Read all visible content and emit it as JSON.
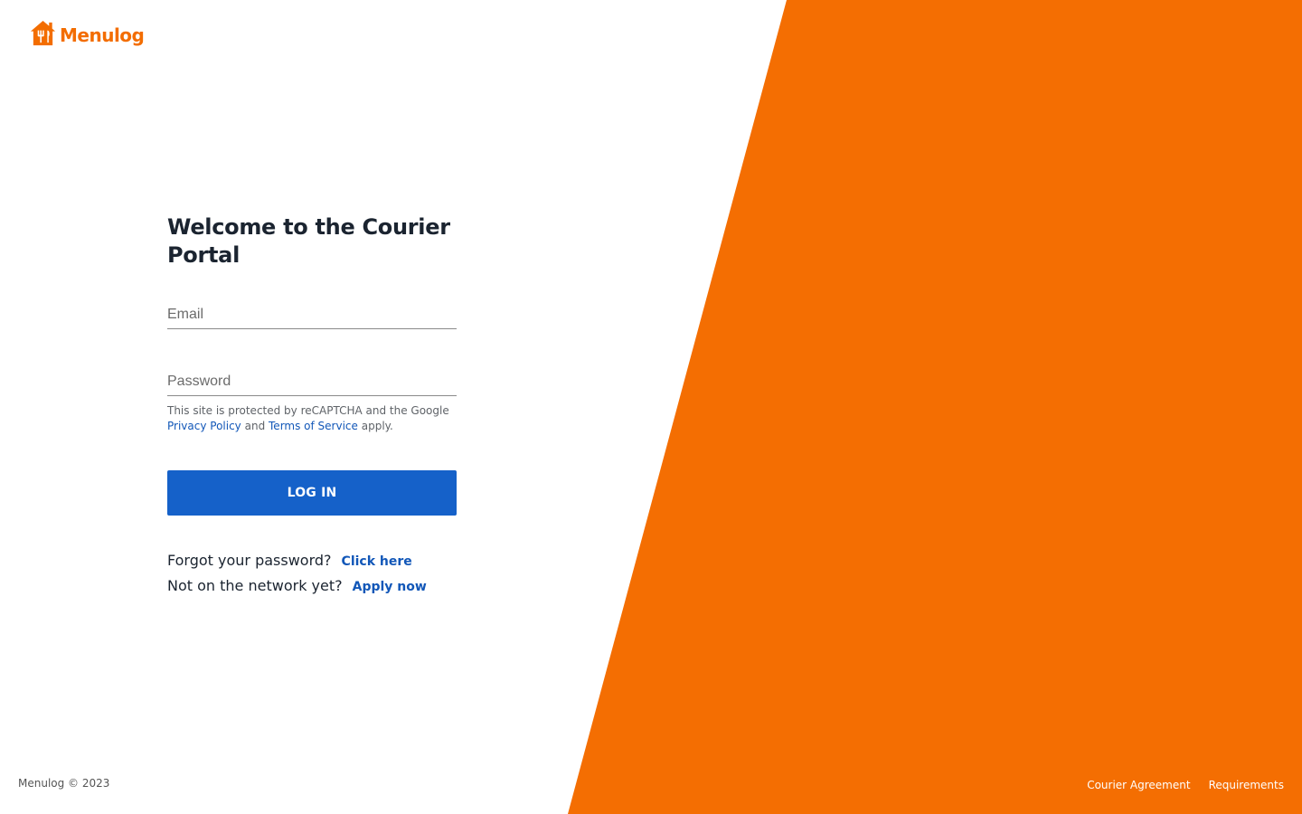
{
  "brand": {
    "name": "Menulog",
    "color": "#f36d00",
    "logo_icon": "house-cutlery-icon"
  },
  "login": {
    "title": "Welcome to the Courier Portal",
    "email_placeholder": "Email",
    "password_placeholder": "Password",
    "recaptcha": {
      "text_before": "This site is protected by reCAPTCHA and the Google",
      "privacy_label": "Privacy Policy",
      "and_text": "and",
      "terms_label": "Terms of Service",
      "apply_text": "apply."
    },
    "login_button": "LOG IN",
    "button_color": "#1561c9",
    "link_color": "#1257b8"
  },
  "help": {
    "forgot_text": "Forgot your password?",
    "forgot_link": "Click here",
    "network_text": "Not on the network yet?",
    "network_link": "Apply now"
  },
  "footer": {
    "copyright": "Menulog © 2023",
    "links": [
      "Courier Agreement",
      "Requirements"
    ]
  }
}
